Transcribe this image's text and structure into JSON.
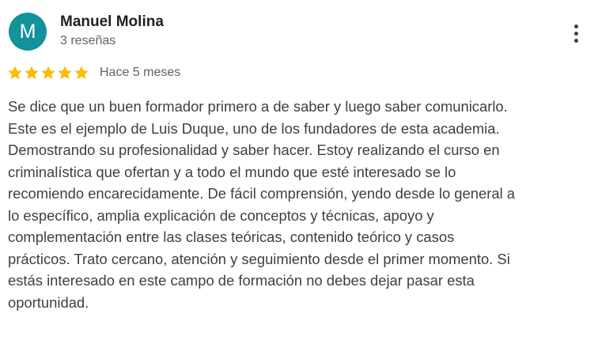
{
  "review": {
    "author": {
      "initial": "M",
      "name": "Manuel Molina",
      "review_count": "3 reseñas",
      "avatar_color": "#12939b"
    },
    "rating": 5,
    "rating_max": 5,
    "star_color": "#fbbc04",
    "date": "Hace 5 meses",
    "text_lines": [
      "Se dice que un buen formador primero a de saber y luego saber comunicarlo.",
      "Este es el ejemplo de Luis Duque, uno de los fundadores de esta academia.",
      "Demostrando su profesionalidad y saber hacer. Estoy realizando el curso en",
      "criminalística que ofertan y a todo el mundo que esté interesado se lo",
      "recomiendo encarecidamente. De fácil comprensión, yendo desde lo general a",
      "lo específico, amplia explicación de conceptos y técnicas, apoyo y",
      "complementación entre las clases teóricas, contenido teórico y casos",
      "prácticos. Trato cercano, atención y seguimiento desde el primer momento. Si",
      "estás interesado en este campo de formación no debes dejar pasar esta",
      "oportunidad."
    ],
    "menu_icon": "more-vertical-icon"
  }
}
